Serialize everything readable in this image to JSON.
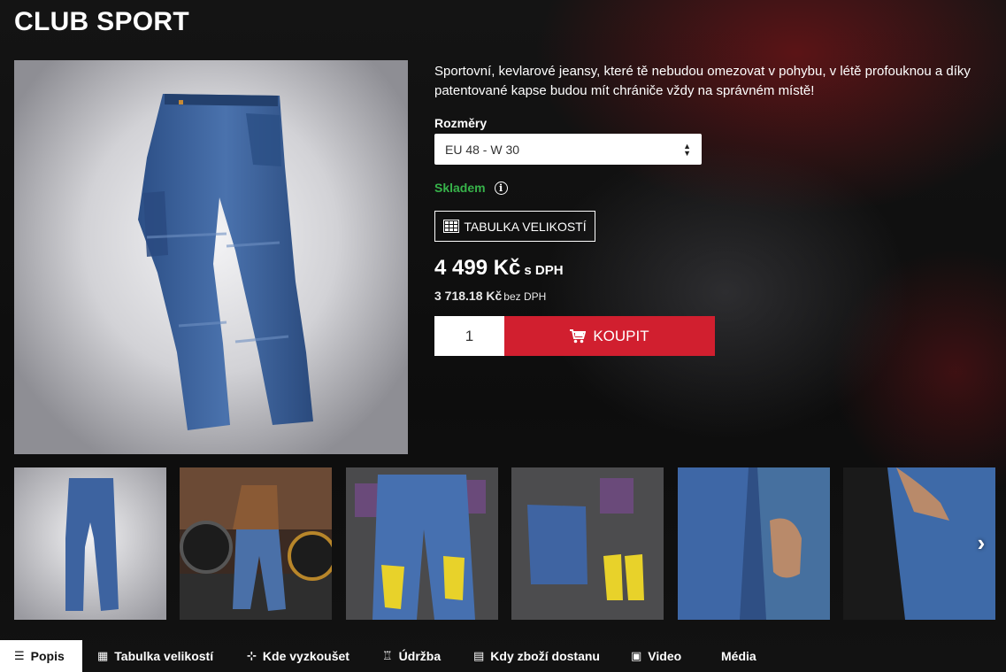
{
  "product": {
    "title": "CLUB SPORT",
    "description": "Sportovní, kevlarové jeansy, které tě nebudou omezovat v pohybu, v létě profouknou a díky patentované kapse budou mít chrániče vždy na správném místě!",
    "size_label": "Rozměry",
    "size_selected": "EU 48 - W 30",
    "stock_status": "Skladem",
    "size_table_button": "TABULKA VELIKOSTÍ",
    "price_with_vat": "4 499 Kč",
    "price_with_vat_suffix": "s DPH",
    "price_without_vat": "3 718.18 Kč",
    "price_without_vat_suffix": "bez DPH",
    "quantity": "1",
    "buy_button": "KOUPIT"
  },
  "icons": {
    "info": "info-icon",
    "grid": "grid-icon",
    "cart": "cart-icon",
    "next": "chevron-right-icon"
  },
  "tabs": [
    {
      "label": "Popis",
      "icon": "list-icon",
      "active": true
    },
    {
      "label": "Tabulka velikostí",
      "icon": "table-icon",
      "active": false
    },
    {
      "label": "Kde vyzkoušet",
      "icon": "signpost-icon",
      "active": false
    },
    {
      "label": "Údržba",
      "icon": "shirt-icon",
      "active": false
    },
    {
      "label": "Kdy zboží dostanu",
      "icon": "calendar-icon",
      "active": false
    },
    {
      "label": "Video",
      "icon": "film-icon",
      "active": false
    },
    {
      "label": "Média",
      "icon": "",
      "active": false
    }
  ],
  "colors": {
    "accent_red": "#d11f2f",
    "stock_green": "#37b34a",
    "denim": "#3a5f96"
  }
}
